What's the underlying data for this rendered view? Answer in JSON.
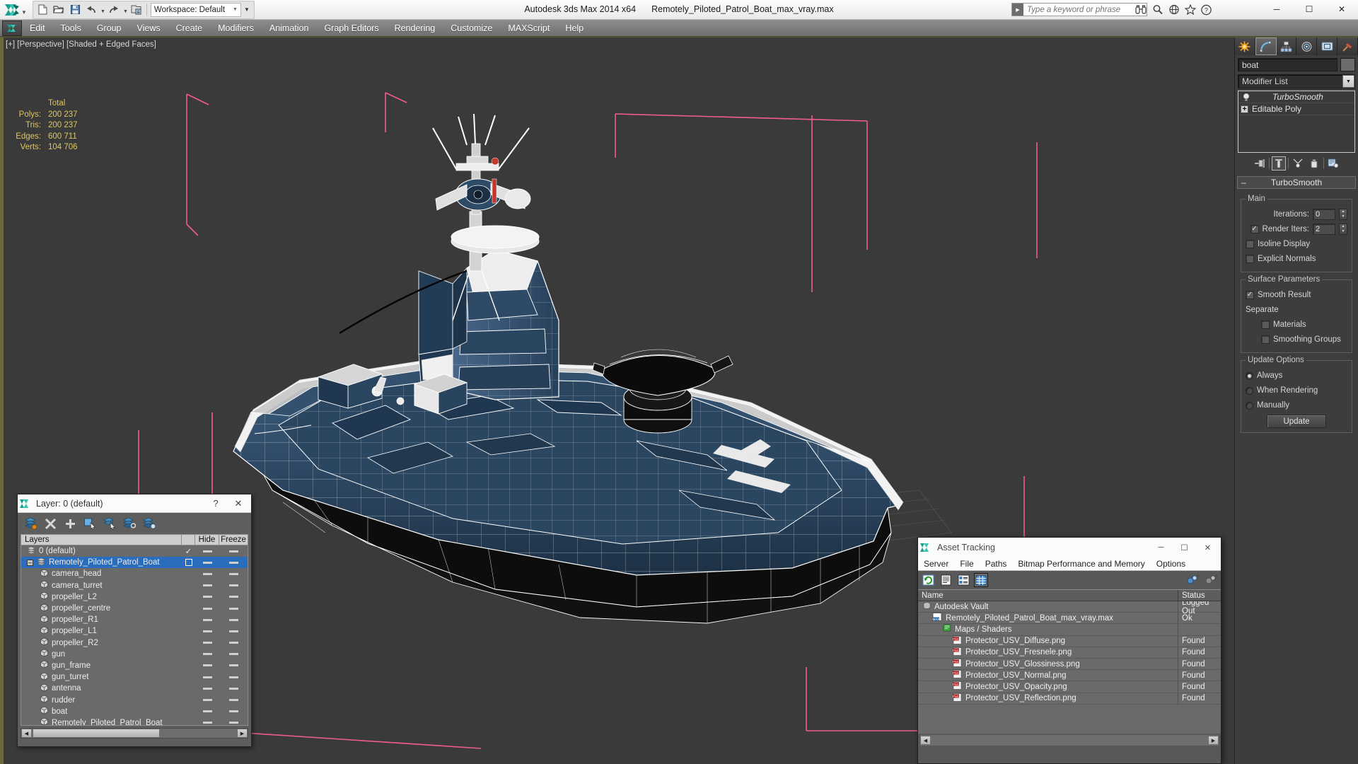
{
  "app": {
    "title": "Autodesk 3ds Max  2014 x64",
    "file": "Remotely_Piloted_Patrol_Boat_max_vray.max",
    "workspace": "Workspace: Default",
    "search_placeholder": "Type a keyword or phrase"
  },
  "quick_access": {
    "new_label": "New",
    "open_label": "Open",
    "save_label": "Save",
    "undo_label": "Undo",
    "redo_label": "Redo",
    "project_label": "Set Project Folder"
  },
  "window_controls": {
    "minimize": "─",
    "maximize": "☐",
    "close": "✕"
  },
  "menu": {
    "items": [
      "Edit",
      "Tools",
      "Group",
      "Views",
      "Create",
      "Modifiers",
      "Animation",
      "Graph Editors",
      "Rendering",
      "Customize",
      "MAXScript",
      "Help"
    ]
  },
  "viewport": {
    "label": "[+] [Perspective] [Shaded + Edged Faces]",
    "stats": {
      "header": "Total",
      "rows": [
        {
          "label": "Polys:",
          "value": "200 237"
        },
        {
          "label": "Tris:",
          "value": "200 237"
        },
        {
          "label": "Edges:",
          "value": "600 711"
        },
        {
          "label": "Verts:",
          "value": "104 706"
        }
      ]
    },
    "colors": {
      "hull": "#2e4a66",
      "hull_dark": "#1d3145",
      "wire": "#ffffff",
      "black": "#0c0c0c",
      "gizmo": "#ef5d8f",
      "background": "#3a3a3a"
    }
  },
  "command_panel": {
    "tabs": [
      {
        "name": "create",
        "label": "Create"
      },
      {
        "name": "modify",
        "label": "Modify"
      },
      {
        "name": "hierarchy",
        "label": "Hierarchy"
      },
      {
        "name": "motion",
        "label": "Motion"
      },
      {
        "name": "display",
        "label": "Display"
      },
      {
        "name": "utilities",
        "label": "Utilities"
      }
    ],
    "object_name": "boat",
    "modifier_list_label": "Modifier List",
    "modifier_stack": [
      {
        "label": "TurboSmooth",
        "italic": true
      },
      {
        "label": "Editable Poly",
        "italic": false
      }
    ],
    "stack_buttons": [
      "pin-stack",
      "show-end-result",
      "make-unique",
      "remove-modifier",
      "configure-sets"
    ],
    "rollout": {
      "title": "TurboSmooth",
      "main_legend": "Main",
      "iterations_label": "Iterations:",
      "iterations_value": "0",
      "render_iters_label": "Render Iters:",
      "render_iters_value": "2",
      "render_iters_checked": true,
      "isoline_label": "Isoline Display",
      "isoline_checked": false,
      "explicit_label": "Explicit Normals",
      "explicit_checked": false,
      "surface_legend": "Surface Parameters",
      "smooth_result_label": "Smooth Result",
      "smooth_result_checked": true,
      "separate_label": "Separate",
      "materials_label": "Materials",
      "materials_checked": false,
      "smoothing_groups_label": "Smoothing Groups",
      "smoothing_groups_checked": false,
      "update_legend": "Update Options",
      "update_options": [
        {
          "label": "Always",
          "selected": true
        },
        {
          "label": "When Rendering",
          "selected": false
        },
        {
          "label": "Manually",
          "selected": false
        }
      ],
      "update_button": "Update"
    }
  },
  "layer_dialog": {
    "title": "Layer: 0 (default)",
    "help_glyph": "?",
    "close_glyph": "✕",
    "toolbar": [
      "create-new-layer",
      "delete-layer",
      "add-selection-to-layer",
      "select-objects-in-layer",
      "select-highlighted-objects-layers",
      "highlight-selected-objects-layers",
      "layer-properties"
    ],
    "columns": {
      "name": "Layers",
      "hide": "Hide",
      "freeze": "Freeze"
    },
    "rows": [
      {
        "label": "0 (default)",
        "indent": 0,
        "type": "layer",
        "selected": false,
        "current": true
      },
      {
        "label": "Remotely_Piloted_Patrol_Boat",
        "indent": 0,
        "type": "layer",
        "selected": true,
        "expandable": true
      },
      {
        "label": "camera_head",
        "indent": 1,
        "type": "object"
      },
      {
        "label": "camera_turret",
        "indent": 1,
        "type": "object"
      },
      {
        "label": "propeller_L2",
        "indent": 1,
        "type": "object"
      },
      {
        "label": "propeller_centre",
        "indent": 1,
        "type": "object"
      },
      {
        "label": "propeller_R1",
        "indent": 1,
        "type": "object"
      },
      {
        "label": "propeller_L1",
        "indent": 1,
        "type": "object"
      },
      {
        "label": "propeller_R2",
        "indent": 1,
        "type": "object"
      },
      {
        "label": "gun",
        "indent": 1,
        "type": "object"
      },
      {
        "label": "gun_frame",
        "indent": 1,
        "type": "object"
      },
      {
        "label": "gun_turret",
        "indent": 1,
        "type": "object"
      },
      {
        "label": "antenna",
        "indent": 1,
        "type": "object"
      },
      {
        "label": "rudder",
        "indent": 1,
        "type": "object"
      },
      {
        "label": "boat",
        "indent": 1,
        "type": "object"
      },
      {
        "label": "Remotely_Piloted_Patrol_Boat",
        "indent": 1,
        "type": "object"
      }
    ]
  },
  "asset_tracking": {
    "title": "Asset Tracking",
    "menu": [
      "Server",
      "File",
      "Paths",
      "Bitmap Performance and Memory",
      "Options"
    ],
    "toolbar": [
      "refresh-icon",
      "list-view-icon",
      "details-view-icon",
      "table-view-icon",
      "add-path-icon",
      "remove-path-icon"
    ],
    "columns": {
      "name": "Name",
      "status": "Status"
    },
    "rows": [
      {
        "name": "Autodesk Vault",
        "status": "Logged Out",
        "indent": 0,
        "icon": "vault-icon"
      },
      {
        "name": "Remotely_Piloted_Patrol_Boat_max_vray.max",
        "status": "Ok",
        "indent": 1,
        "icon": "max-file-icon"
      },
      {
        "name": "Maps / Shaders",
        "status": "",
        "indent": 2,
        "icon": "maps-icon"
      },
      {
        "name": "Protector_USV_Diffuse.png",
        "status": "Found",
        "indent": 3,
        "icon": "png-icon"
      },
      {
        "name": "Protector_USV_Fresnele.png",
        "status": "Found",
        "indent": 3,
        "icon": "png-icon"
      },
      {
        "name": "Protector_USV_Glossiness.png",
        "status": "Found",
        "indent": 3,
        "icon": "png-icon"
      },
      {
        "name": "Protector_USV_Normal.png",
        "status": "Found",
        "indent": 3,
        "icon": "png-icon"
      },
      {
        "name": "Protector_USV_Opacity.png",
        "status": "Found",
        "indent": 3,
        "icon": "png-icon"
      },
      {
        "name": "Protector_USV_Reflection.png",
        "status": "Found",
        "indent": 3,
        "icon": "png-icon"
      }
    ],
    "window_controls": {
      "minimize": "─",
      "maximize": "☐",
      "close": "✕"
    }
  }
}
